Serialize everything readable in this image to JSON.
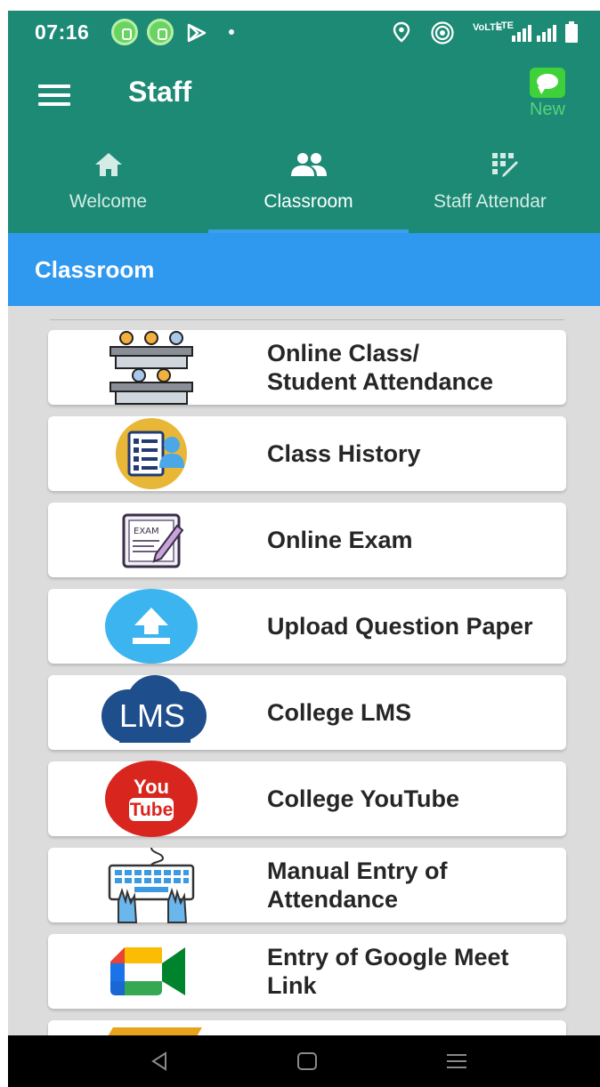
{
  "status_bar": {
    "time": "07:16",
    "network_text": "LTE"
  },
  "app_bar": {
    "title": "Staff",
    "new_label": "New"
  },
  "tabs": [
    {
      "label": "Welcome",
      "icon": "home-icon",
      "active": false
    },
    {
      "label": "Classroom",
      "icon": "people-icon",
      "active": true
    },
    {
      "label": "Staff Attendar",
      "icon": "attendance-icon",
      "active": false
    }
  ],
  "section": {
    "title": "Classroom"
  },
  "menu_items": [
    {
      "label": "Online Class/\nStudent Attendance",
      "icon": "classroom-icon"
    },
    {
      "label": "Class History",
      "icon": "class-history-icon"
    },
    {
      "label": "Online Exam",
      "icon": "exam-icon"
    },
    {
      "label": "Upload Question Paper",
      "icon": "upload-icon"
    },
    {
      "label": "College LMS",
      "icon": "lms-icon"
    },
    {
      "label": "College YouTube",
      "icon": "youtube-icon"
    },
    {
      "label": "Manual Entry of Attendance",
      "icon": "keyboard-icon"
    },
    {
      "label": "Entry of Google Meet Link",
      "icon": "google-meet-icon"
    }
  ],
  "lms_text": "LMS",
  "youtube_text": {
    "top": "You",
    "bottom": "Tube"
  },
  "exam_text": "EXAM",
  "colors": {
    "app_bar": "#1c8a74",
    "section_header": "#2f98ef",
    "tab_indicator": "#3aa0ea",
    "list_bg": "#dcdcdc"
  }
}
